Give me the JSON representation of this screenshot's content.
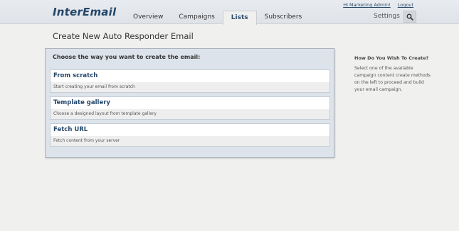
{
  "app": {
    "logo": "InterEmail"
  },
  "nav": {
    "tabs": [
      {
        "label": "Overview",
        "active": false
      },
      {
        "label": "Campaigns",
        "active": false
      },
      {
        "label": "Lists",
        "active": true
      },
      {
        "label": "Subscribers",
        "active": false
      }
    ],
    "greeting_link": "Hi Marketing Admin!",
    "logout_link": "Logout",
    "settings_label": "Settings",
    "search_icon": "search-icon"
  },
  "page": {
    "title": "Create New Auto Responder Email"
  },
  "panel": {
    "heading": "Choose the way you want to create the email:",
    "options": [
      {
        "title": "From scratch",
        "description": "Start creating your email from scratch"
      },
      {
        "title": "Template gallery",
        "description": "Choose a designed layout from template gallery"
      },
      {
        "title": "Fetch URL",
        "description": "Fetch content from your server"
      }
    ]
  },
  "help": {
    "title": "How Do You Wish To Create?",
    "text": "Select one of the available campaign content create methods on the left to proceed and build your email campaign."
  },
  "colors": {
    "brand": "#25476a",
    "panel_bg": "#dde3ea",
    "page_bg": "#f0f0ef"
  }
}
